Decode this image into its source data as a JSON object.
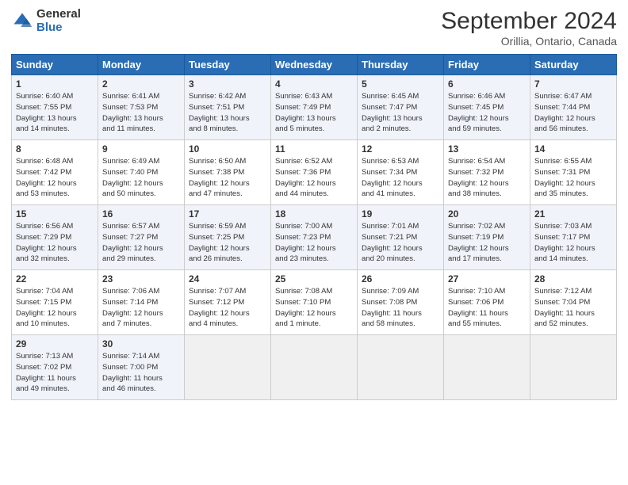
{
  "header": {
    "logo_general": "General",
    "logo_blue": "Blue",
    "month_title": "September 2024",
    "subtitle": "Orillia, Ontario, Canada"
  },
  "columns": [
    "Sunday",
    "Monday",
    "Tuesday",
    "Wednesday",
    "Thursday",
    "Friday",
    "Saturday"
  ],
  "weeks": [
    [
      {
        "day": "1",
        "info": "Sunrise: 6:40 AM\nSunset: 7:55 PM\nDaylight: 13 hours\nand 14 minutes."
      },
      {
        "day": "2",
        "info": "Sunrise: 6:41 AM\nSunset: 7:53 PM\nDaylight: 13 hours\nand 11 minutes."
      },
      {
        "day": "3",
        "info": "Sunrise: 6:42 AM\nSunset: 7:51 PM\nDaylight: 13 hours\nand 8 minutes."
      },
      {
        "day": "4",
        "info": "Sunrise: 6:43 AM\nSunset: 7:49 PM\nDaylight: 13 hours\nand 5 minutes."
      },
      {
        "day": "5",
        "info": "Sunrise: 6:45 AM\nSunset: 7:47 PM\nDaylight: 13 hours\nand 2 minutes."
      },
      {
        "day": "6",
        "info": "Sunrise: 6:46 AM\nSunset: 7:45 PM\nDaylight: 12 hours\nand 59 minutes."
      },
      {
        "day": "7",
        "info": "Sunrise: 6:47 AM\nSunset: 7:44 PM\nDaylight: 12 hours\nand 56 minutes."
      }
    ],
    [
      {
        "day": "8",
        "info": "Sunrise: 6:48 AM\nSunset: 7:42 PM\nDaylight: 12 hours\nand 53 minutes."
      },
      {
        "day": "9",
        "info": "Sunrise: 6:49 AM\nSunset: 7:40 PM\nDaylight: 12 hours\nand 50 minutes."
      },
      {
        "day": "10",
        "info": "Sunrise: 6:50 AM\nSunset: 7:38 PM\nDaylight: 12 hours\nand 47 minutes."
      },
      {
        "day": "11",
        "info": "Sunrise: 6:52 AM\nSunset: 7:36 PM\nDaylight: 12 hours\nand 44 minutes."
      },
      {
        "day": "12",
        "info": "Sunrise: 6:53 AM\nSunset: 7:34 PM\nDaylight: 12 hours\nand 41 minutes."
      },
      {
        "day": "13",
        "info": "Sunrise: 6:54 AM\nSunset: 7:32 PM\nDaylight: 12 hours\nand 38 minutes."
      },
      {
        "day": "14",
        "info": "Sunrise: 6:55 AM\nSunset: 7:31 PM\nDaylight: 12 hours\nand 35 minutes."
      }
    ],
    [
      {
        "day": "15",
        "info": "Sunrise: 6:56 AM\nSunset: 7:29 PM\nDaylight: 12 hours\nand 32 minutes."
      },
      {
        "day": "16",
        "info": "Sunrise: 6:57 AM\nSunset: 7:27 PM\nDaylight: 12 hours\nand 29 minutes."
      },
      {
        "day": "17",
        "info": "Sunrise: 6:59 AM\nSunset: 7:25 PM\nDaylight: 12 hours\nand 26 minutes."
      },
      {
        "day": "18",
        "info": "Sunrise: 7:00 AM\nSunset: 7:23 PM\nDaylight: 12 hours\nand 23 minutes."
      },
      {
        "day": "19",
        "info": "Sunrise: 7:01 AM\nSunset: 7:21 PM\nDaylight: 12 hours\nand 20 minutes."
      },
      {
        "day": "20",
        "info": "Sunrise: 7:02 AM\nSunset: 7:19 PM\nDaylight: 12 hours\nand 17 minutes."
      },
      {
        "day": "21",
        "info": "Sunrise: 7:03 AM\nSunset: 7:17 PM\nDaylight: 12 hours\nand 14 minutes."
      }
    ],
    [
      {
        "day": "22",
        "info": "Sunrise: 7:04 AM\nSunset: 7:15 PM\nDaylight: 12 hours\nand 10 minutes."
      },
      {
        "day": "23",
        "info": "Sunrise: 7:06 AM\nSunset: 7:14 PM\nDaylight: 12 hours\nand 7 minutes."
      },
      {
        "day": "24",
        "info": "Sunrise: 7:07 AM\nSunset: 7:12 PM\nDaylight: 12 hours\nand 4 minutes."
      },
      {
        "day": "25",
        "info": "Sunrise: 7:08 AM\nSunset: 7:10 PM\nDaylight: 12 hours\nand 1 minute."
      },
      {
        "day": "26",
        "info": "Sunrise: 7:09 AM\nSunset: 7:08 PM\nDaylight: 11 hours\nand 58 minutes."
      },
      {
        "day": "27",
        "info": "Sunrise: 7:10 AM\nSunset: 7:06 PM\nDaylight: 11 hours\nand 55 minutes."
      },
      {
        "day": "28",
        "info": "Sunrise: 7:12 AM\nSunset: 7:04 PM\nDaylight: 11 hours\nand 52 minutes."
      }
    ],
    [
      {
        "day": "29",
        "info": "Sunrise: 7:13 AM\nSunset: 7:02 PM\nDaylight: 11 hours\nand 49 minutes."
      },
      {
        "day": "30",
        "info": "Sunrise: 7:14 AM\nSunset: 7:00 PM\nDaylight: 11 hours\nand 46 minutes."
      },
      {
        "day": "",
        "info": ""
      },
      {
        "day": "",
        "info": ""
      },
      {
        "day": "",
        "info": ""
      },
      {
        "day": "",
        "info": ""
      },
      {
        "day": "",
        "info": ""
      }
    ]
  ]
}
